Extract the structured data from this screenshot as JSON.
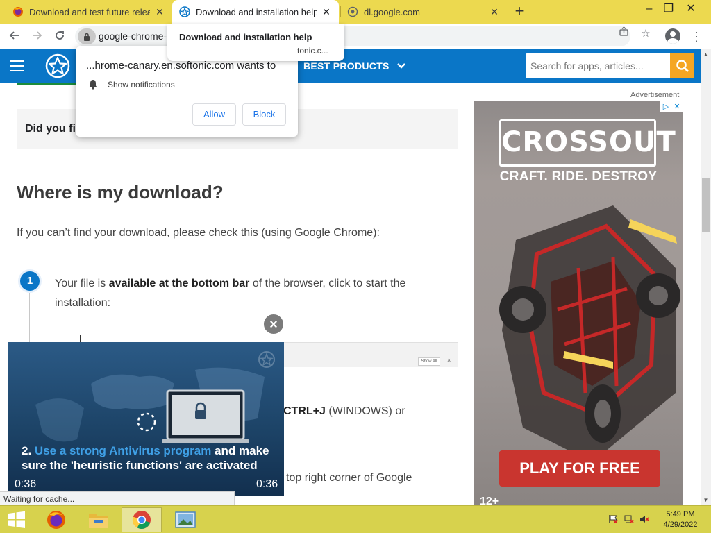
{
  "tabs": [
    {
      "title": "Download and test future releas",
      "active": false,
      "icon": "firefox-icon"
    },
    {
      "title": "Download and installation help",
      "active": true,
      "icon": "softonic-icon"
    },
    {
      "title": "dl.google.com",
      "active": false,
      "icon": "globe-icon"
    }
  ],
  "new_tab_label": "+",
  "window_controls": {
    "minimize": "–",
    "maximize": "❐",
    "close": "✕"
  },
  "omnibox": {
    "url": "google-chrome-"
  },
  "tab_tooltip": {
    "title": "Download and installation help",
    "domain": "tonic.c..."
  },
  "permission_popup": {
    "title": "...hrome-canary.en.softonic.com wants to",
    "request": "Show notifications",
    "allow": "Allow",
    "block": "Block",
    "close": "×"
  },
  "site_header": {
    "nav_label": "BEST PRODUCTS",
    "search_placeholder": "Search for apps, articles..."
  },
  "content": {
    "did_you": "Did you fi",
    "heading": "Where is my download?",
    "intro": "If you can’t find your download, please check this (using Google Chrome):",
    "step_number": "1",
    "step_text_a": "Your file is ",
    "step_text_bold": "available at the bottom bar",
    "step_text_b": " of the browser, click to start the installation:",
    "show_all": "Show All",
    "shot_close": "×",
    "ctrlj_bold": "CTRL+J",
    "ctrlj_rest": " (WINDOWS) or",
    "top_right": "top right corner of Google"
  },
  "ad": {
    "label": "Advertisement",
    "brand": "CROSSOUT",
    "tagline": "CRAFT. RIDE. DESTROY",
    "cta": "PLAY FOR FREE",
    "age": "12+"
  },
  "video": {
    "caption_num": "2. ",
    "caption_highlight": "Use a strong Antivirus program",
    "caption_rest": " and make sure the 'heuristic functions' are activated",
    "time_left": "0:36",
    "time_right": "0:36",
    "close": "×"
  },
  "status_text": "Waiting for cache...",
  "clock": {
    "time": "5:49 PM",
    "date": "4/29/2022"
  },
  "colors": {
    "chrome_frame": "#ecd94f",
    "site_blue": "#0a76c7",
    "search_orange": "#f5a623",
    "ad_red": "#c9352f",
    "taskbar": "#d7d24d"
  }
}
